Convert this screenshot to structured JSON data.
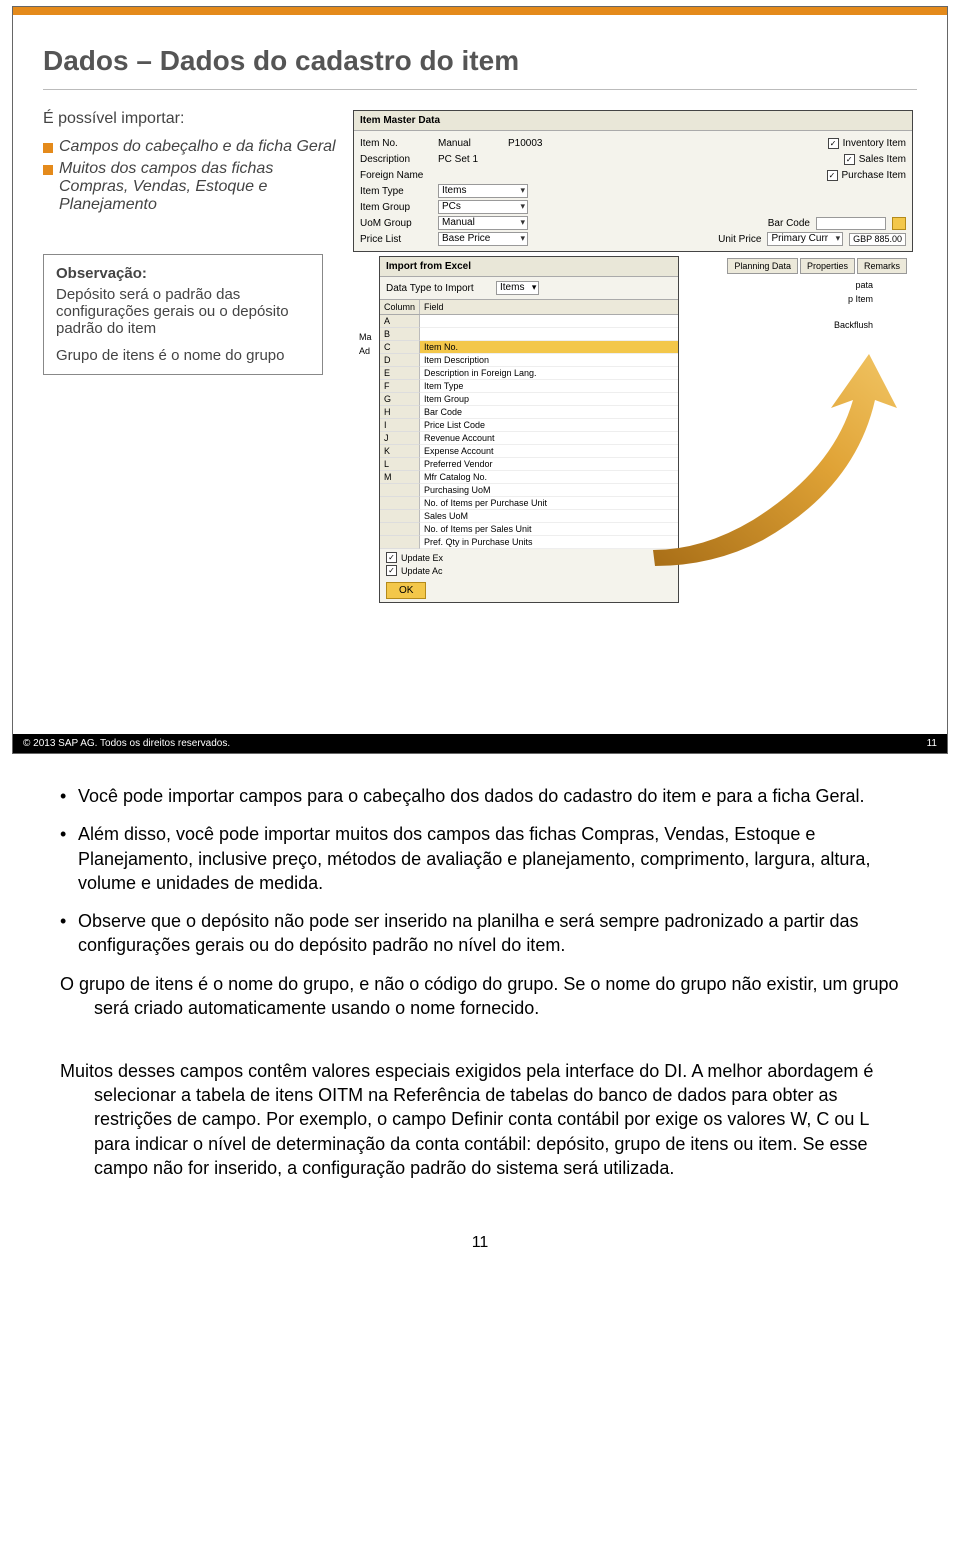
{
  "slide": {
    "title": "Dados – Dados do cadastro do item",
    "intro": "É possível importar:",
    "bullet1": "Campos do cabeçalho e da ficha Geral",
    "bullet2": "Muitos dos campos das fichas Compras, Vendas, Estoque e Planejamento",
    "note_title": "Observação:",
    "note_body1": "Depósito será o padrão das configurações gerais ou o depósito padrão do item",
    "note_body2": "Grupo de itens é o nome do grupo",
    "copyright": "© 2013 SAP AG. Todos os direitos reservados.",
    "pagenum": "11"
  },
  "master": {
    "title": "Item Master Data",
    "rows": {
      "item_no": {
        "label": "Item No.",
        "v1": "Manual",
        "v2": "P10003"
      },
      "description": {
        "label": "Description",
        "value": "PC Set 1"
      },
      "foreign": {
        "label": "Foreign Name"
      },
      "item_type": {
        "label": "Item Type",
        "value": "Items"
      },
      "item_group": {
        "label": "Item Group",
        "value": "PCs"
      },
      "uom_group": {
        "label": "UoM Group",
        "value": "Manual"
      },
      "price_list": {
        "label": "Price List",
        "value": "Base Price"
      }
    },
    "checks": {
      "inventory": "Inventory Item",
      "sales": "Sales Item",
      "purchase": "Purchase Item"
    },
    "right": {
      "bar_code": "Bar Code",
      "unit_price": "Unit Price",
      "primary_curr": "Primary Curr",
      "gbp": "GBP 885.00"
    },
    "tabs_right": {
      "planning": "Planning Data",
      "properties": "Properties",
      "remarks": "Remarks"
    },
    "side": {
      "pata": "pata",
      "item": "p Item",
      "backflush": "Backflush"
    },
    "small_labels": {
      "ma": "Ma",
      "ad": "Ad"
    }
  },
  "import": {
    "title": "Import from Excel",
    "lbl_data_type": "Data Type to Import",
    "data_type": "Items",
    "head_col": "Column",
    "head_field": "Field",
    "rows": [
      {
        "col": "A",
        "field": ""
      },
      {
        "col": "B",
        "field": ""
      },
      {
        "col": "C",
        "field": "Item No."
      },
      {
        "col": "D",
        "field": "Item Description"
      },
      {
        "col": "E",
        "field": "Description in Foreign Lang."
      },
      {
        "col": "F",
        "field": "Item Type"
      },
      {
        "col": "G",
        "field": "Item Group"
      },
      {
        "col": "H",
        "field": "Bar Code"
      },
      {
        "col": "I",
        "field": "Price List Code"
      },
      {
        "col": "J",
        "field": "Revenue Account"
      },
      {
        "col": "K",
        "field": "Expense Account"
      },
      {
        "col": "L",
        "field": "Preferred Vendor"
      },
      {
        "col": "M",
        "field": "Mfr Catalog No."
      },
      {
        "col": "",
        "field": "Purchasing UoM"
      },
      {
        "col": "",
        "field": "No. of Items per Purchase Unit"
      },
      {
        "col": "",
        "field": "Sales UoM"
      },
      {
        "col": "",
        "field": "No. of Items per Sales Unit"
      },
      {
        "col": "",
        "field": "Pref. Qty in Purchase Units"
      }
    ],
    "update_ex": "Update Ex",
    "update_ac": "Update Ac",
    "ok": "OK"
  },
  "notes": {
    "b1": "Você pode importar campos para o cabeçalho dos dados do cadastro do item e para a ficha Geral.",
    "b2": "Além disso, você pode importar muitos dos campos das fichas Compras, Vendas, Estoque e Planejamento, inclusive preço, métodos de avaliação e planejamento, comprimento, largura, altura, volume e unidades de medida.",
    "b3": "Observe que o depósito não pode ser inserido na planilha e será sempre padronizado a partir das configurações gerais ou do depósito padrão no nível do item.",
    "b4": "O grupo de itens é o nome do grupo, e não o código do grupo. Se o nome do grupo não existir, um grupo será criado automaticamente usando o nome fornecido.",
    "p1": "Muitos desses campos contêm valores especiais exigidos pela interface do DI. A melhor abordagem é selecionar a tabela de itens OITM na Referência de tabelas do banco de dados para obter as restrições de campo. Por exemplo, o campo Definir conta contábil por exige os valores W, C ou L para indicar o nível de determinação da conta contábil: depósito, grupo de itens ou item. Se esse campo não for inserido, a configuração padrão do sistema será utilizada.",
    "pagenum": "11"
  }
}
